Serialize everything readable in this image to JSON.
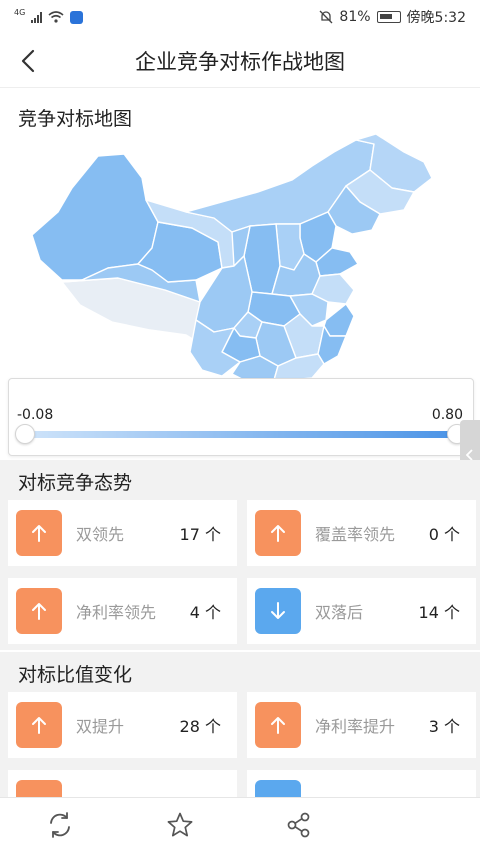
{
  "status": {
    "network": "4G",
    "battery_pct": "81%",
    "time": "傍晚5:32"
  },
  "header": {
    "title": "企业竞争对标作战地图"
  },
  "map_section": {
    "title": "竞争对标地图"
  },
  "range": {
    "min_label": "-0.08",
    "max_label": "0.80",
    "min_value": -0.08,
    "max_value": 0.8
  },
  "situation": {
    "title": "对标竞争态势",
    "tiles": [
      {
        "label": "双领先",
        "count": "17 个",
        "direction": "up"
      },
      {
        "label": "覆盖率领先",
        "count": "0 个",
        "direction": "up"
      },
      {
        "label": "净利率领先",
        "count": "4 个",
        "direction": "up"
      },
      {
        "label": "双落后",
        "count": "14 个",
        "direction": "down"
      }
    ]
  },
  "ratio_change": {
    "title": "对标比值变化",
    "tiles": [
      {
        "label": "双提升",
        "count": "28 个",
        "direction": "up"
      },
      {
        "label": "净利率提升",
        "count": "3 个",
        "direction": "up"
      }
    ]
  },
  "colors": {
    "up": "#f7925e",
    "down": "#5ba8ee",
    "map_dark": "#86bdf2",
    "map_light": "#c4def8"
  },
  "bottom_icons": [
    "refresh-icon",
    "star-icon",
    "share-icon"
  ]
}
